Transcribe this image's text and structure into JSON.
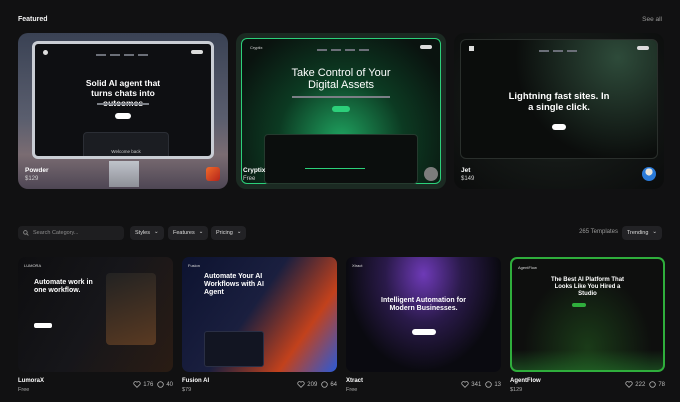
{
  "header": {
    "title": "Featured",
    "see_all": "See all"
  },
  "featured": [
    {
      "name": "Powder",
      "price": "$129",
      "hero": "Solid AI agent that turns chats into outcomes",
      "screen_title": "Welcome back",
      "avatar_color": "#e8542a"
    },
    {
      "name": "Cryptix",
      "price": "Free",
      "hero": "Take Control of Your Digital Assets",
      "nav_brand": "Cryptix",
      "avatar_color": "#888888"
    },
    {
      "name": "Jet",
      "price": "$149",
      "hero": "Lightning fast sites. In a single click.",
      "avatar_color": "#2a7ad8"
    }
  ],
  "filters": {
    "search_placeholder": "Search Category...",
    "styles": "Styles",
    "features": "Features",
    "pricing": "Pricing",
    "count": "265 Templates",
    "sort": "Trending"
  },
  "templates": [
    {
      "name": "LumoraX",
      "price": "Free",
      "likes": "176",
      "comments": "40",
      "hero": "Automate work in one workflow.",
      "brand": "LUMORA"
    },
    {
      "name": "Fusion AI",
      "price": "$79",
      "likes": "209",
      "comments": "64",
      "hero": "Automate Your AI Workflows with AI Agent",
      "brand": "Fusion"
    },
    {
      "name": "Xtract",
      "price": "Free",
      "likes": "341",
      "comments": "13",
      "hero": "Intelligent Automation for Modern Businesses.",
      "brand": "Xtract"
    },
    {
      "name": "AgentFlow",
      "price": "$129",
      "likes": "222",
      "comments": "78",
      "hero": "The Best AI Platform That Looks Like You Hired a Studio",
      "brand": "AgentFlow"
    }
  ],
  "colors": {
    "accent_green": "#2cd07a",
    "bg": "#111112"
  }
}
